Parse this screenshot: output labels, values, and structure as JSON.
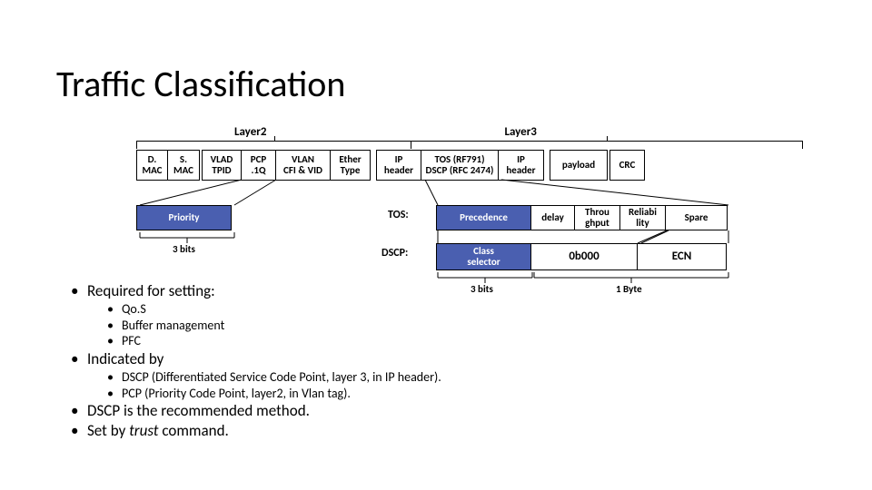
{
  "title": "Traffic Classification",
  "layers": {
    "l2": "Layer2",
    "l3": "Layer3"
  },
  "rowA": {
    "dmac": "D.\nMAC",
    "smac": "S.\nMAC",
    "vlad": "VLAD\nTPID",
    "pcp": "PCP\n.1Q",
    "vlan": "VLAN\nCFI & VID",
    "ether": "Ether\nType",
    "iphdr1": "IP\nheader",
    "tos": "TOS (RF791)\nDSCP (RFC 2474)",
    "iphdr2": "IP\nheader",
    "payload": "payload",
    "crc": "CRC"
  },
  "rowB": {
    "tos_label": "TOS:",
    "priority": "Priority",
    "precedence": "Precedence",
    "delay": "delay",
    "throughput": "Throu\nghput",
    "reliability": "Reliabi\nlity",
    "spare": "Spare"
  },
  "rowC": {
    "dscp_label": "DSCP:",
    "class_sel": "Class\nselector",
    "zeros": "0b000",
    "ecn": "ECN"
  },
  "notes": {
    "bits3_a": "3 bits",
    "bits3_b": "3 bits",
    "byte1": "1 Byte"
  },
  "bullets": {
    "b1": "Required for setting:",
    "b1a": "Qo.S",
    "b1b": "Buffer management",
    "b1c": "PFC",
    "b2": "Indicated by",
    "b2a": "DSCP (Differentiated Service Code Point, layer 3, in IP header).",
    "b2b": "PCP (Priority Code Point, layer2, in Vlan tag).",
    "b3": "DSCP is the recommended method.",
    "b4_pre": "Set by ",
    "b4_em": "trust",
    "b4_post": " command."
  }
}
